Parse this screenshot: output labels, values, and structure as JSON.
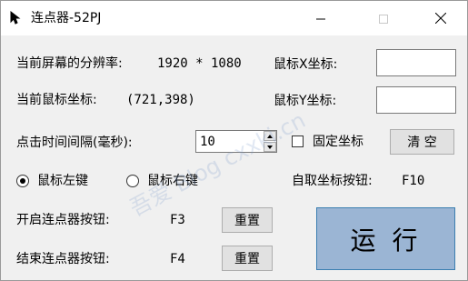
{
  "window": {
    "title": "连点器-52PJ",
    "icon": "app-arrow-icon",
    "controls": {
      "minimize": "minimize-icon",
      "maximize": "maximize-icon",
      "close": "close-icon"
    }
  },
  "screen": {
    "label": "当前屏幕的分辨率:",
    "value": "1920 * 1080"
  },
  "mouse": {
    "label": "当前鼠标坐标:",
    "value": "(721,398)"
  },
  "x_field": {
    "label": "鼠标X坐标:",
    "value": ""
  },
  "y_field": {
    "label": "鼠标Y坐标:",
    "value": ""
  },
  "interval": {
    "label": "点击时间间隔(毫秒):",
    "value": "10"
  },
  "fixed_coord": {
    "label": "固定坐标",
    "checked": false
  },
  "clear_button": {
    "label": "清 空"
  },
  "mouse_button": {
    "options": [
      {
        "label": "鼠标左键",
        "selected": true
      },
      {
        "label": "鼠标右键",
        "selected": false
      }
    ]
  },
  "capture_key": {
    "label": "自取坐标按钮:",
    "value": "F10"
  },
  "start_key": {
    "label": "开启连点器按钮:",
    "value": "F3",
    "reset_label": "重置"
  },
  "stop_key": {
    "label": "结束连点器按钮:",
    "value": "F4",
    "reset_label": "重置"
  },
  "run_button": {
    "label": "运行",
    "color": "#9bb5d4"
  },
  "watermark": {
    "text": "吾爱 Blog  cxxki.cn"
  }
}
